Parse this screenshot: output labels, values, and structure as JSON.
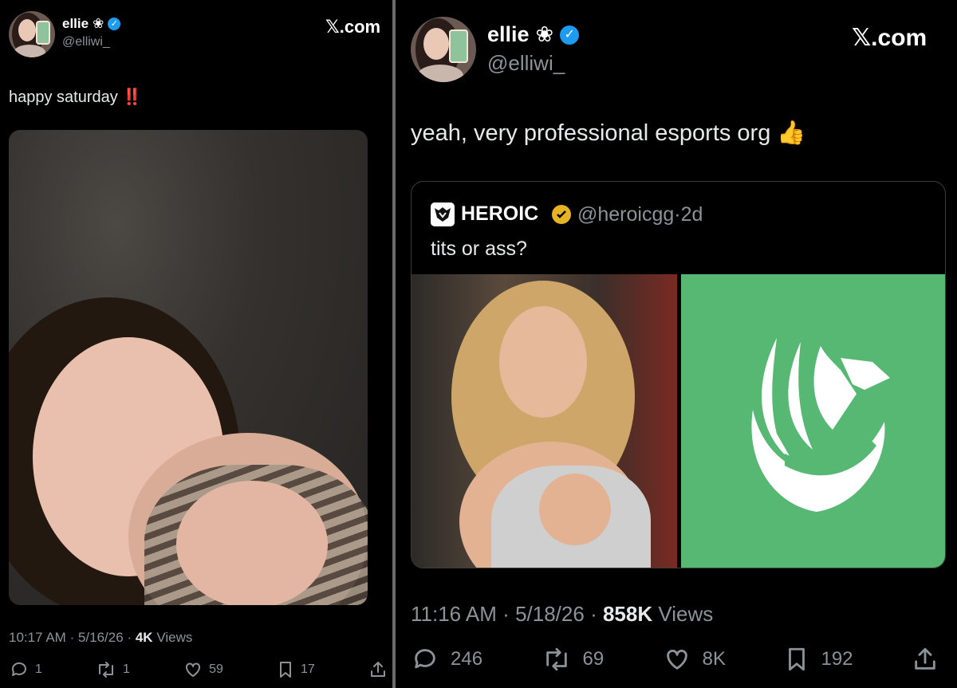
{
  "left_tweet": {
    "display_name": "ellie",
    "name_emoji": "❀",
    "handle": "@elliwi_",
    "site": "𝕏.com",
    "text": "happy saturday",
    "text_emoji": "‼️",
    "time": "10:17 AM",
    "date": "5/16/26",
    "views_count": "4K",
    "views_label": "Views",
    "replies": "1",
    "reposts": "1",
    "likes": "59",
    "bookmarks": "17"
  },
  "right_tweet": {
    "display_name": "ellie",
    "name_emoji": "❀",
    "handle": "@elliwi_",
    "site": "𝕏.com",
    "text": "yeah, very professional esports org",
    "text_emoji": "👍",
    "time": "11:16 AM",
    "date": "5/18/26",
    "views_count": "858K",
    "views_label": "Views",
    "replies": "246",
    "reposts": "69",
    "likes": "8K",
    "bookmarks": "192",
    "quote": {
      "display_name": "HEROIC",
      "handle": "@heroicgg",
      "age": "2d",
      "text": "tits or ass?"
    }
  },
  "colors": {
    "verified_blue": "#1d9bf0",
    "verified_gold": "#e6b325",
    "heroic_green": "#56b872",
    "muted": "#8b9298"
  },
  "separator": "·"
}
